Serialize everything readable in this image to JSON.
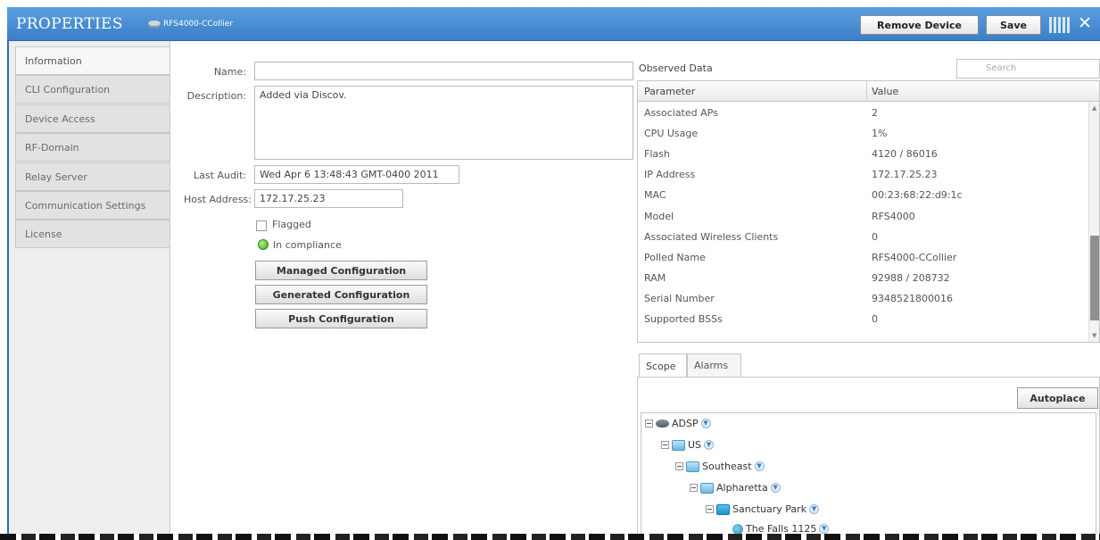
{
  "header": {
    "title": "PROPERTIES",
    "device_name": "RFS4000-CCollier",
    "remove_label": "Remove Device",
    "save_label": "Save",
    "close_glyph": "✕"
  },
  "sidebar": {
    "items": [
      {
        "label": "Information",
        "active": true
      },
      {
        "label": "CLI Configuration"
      },
      {
        "label": "Device Access"
      },
      {
        "label": "RF-Domain"
      },
      {
        "label": "Relay Server"
      },
      {
        "label": "Communication Settings"
      },
      {
        "label": "License"
      }
    ]
  },
  "form": {
    "name_label": "Name:",
    "name_value": "",
    "description_label": "Description:",
    "description_value": "Added via Discov.",
    "last_audit_label": "Last Audit:",
    "last_audit_value": "Wed Apr 6 13:48:43 GMT-0400 2011",
    "host_label": "Host Address:",
    "host_value": "172.17.25.23",
    "flagged_label": "Flagged",
    "compliance_label": "In compliance",
    "managed_btn": "Managed Configuration",
    "generated_btn": "Generated Configuration",
    "push_btn": "Push Configuration"
  },
  "observed": {
    "title": "Observed Data",
    "search_placeholder": "Search",
    "col_parameter": "Parameter",
    "col_value": "Value",
    "rows": [
      {
        "param": "Associated APs",
        "value": "2"
      },
      {
        "param": "CPU Usage",
        "value": "1%"
      },
      {
        "param": "Flash",
        "value": "4120 / 86016"
      },
      {
        "param": "IP Address",
        "value": "172.17.25.23"
      },
      {
        "param": "MAC",
        "value": "00:23:68:22:d9:1c"
      },
      {
        "param": "Model",
        "value": "RFS4000"
      },
      {
        "param": "Associated Wireless Clients",
        "value": "0"
      },
      {
        "param": "Polled Name",
        "value": "RFS4000-CCollier"
      },
      {
        "param": "RAM",
        "value": "92988 / 208732"
      },
      {
        "param": "Serial Number",
        "value": "9348521800016"
      },
      {
        "param": "Supported BSSs",
        "value": "0"
      }
    ]
  },
  "tabs": {
    "scope": "Scope",
    "alarms": "Alarms",
    "autoplace": "Autoplace"
  },
  "tree": {
    "nodes": [
      {
        "label": "ADSP",
        "icon": "network-device-icon"
      },
      {
        "label": "US",
        "icon": "folder-icon"
      },
      {
        "label": "Southeast",
        "icon": "folder-icon"
      },
      {
        "label": "Alpharetta",
        "icon": "folder-icon"
      },
      {
        "label": "Sanctuary Park",
        "icon": "park-icon"
      },
      {
        "label": "The Falls 1125",
        "icon": "building-icon"
      }
    ]
  }
}
